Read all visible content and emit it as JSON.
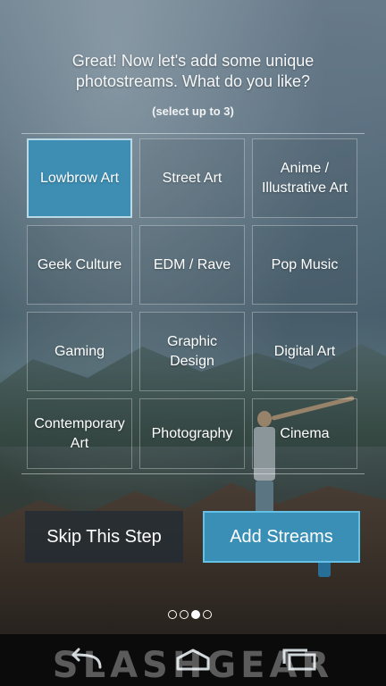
{
  "prompt": {
    "line1": "Great! Now let's add some unique",
    "line2": "photostreams. What do you like?",
    "hint": "(select up to 3)"
  },
  "categories": [
    {
      "label": "Lowbrow Art",
      "selected": true
    },
    {
      "label": "Street Art",
      "selected": false
    },
    {
      "label": "Anime / Illustrative Art",
      "selected": false
    },
    {
      "label": "Geek Culture",
      "selected": false
    },
    {
      "label": "EDM / Rave",
      "selected": false
    },
    {
      "label": "Pop Music",
      "selected": false
    },
    {
      "label": "Gaming",
      "selected": false
    },
    {
      "label": "Graphic Design",
      "selected": false
    },
    {
      "label": "Digital Art",
      "selected": false
    },
    {
      "label": "Contemporary Art",
      "selected": false
    },
    {
      "label": "Photography",
      "selected": false
    },
    {
      "label": "Cinema",
      "selected": false
    }
  ],
  "actions": {
    "skip_label": "Skip This Step",
    "add_label": "Add Streams"
  },
  "pager": {
    "total": 4,
    "active": 3
  },
  "navbar": {
    "icons": [
      "back-icon",
      "home-icon",
      "recent-apps-icon"
    ]
  },
  "watermark": "SLASHGEAR",
  "colors": {
    "accent": "#3a8fb7",
    "selected_tile": "#3e8eb3"
  }
}
